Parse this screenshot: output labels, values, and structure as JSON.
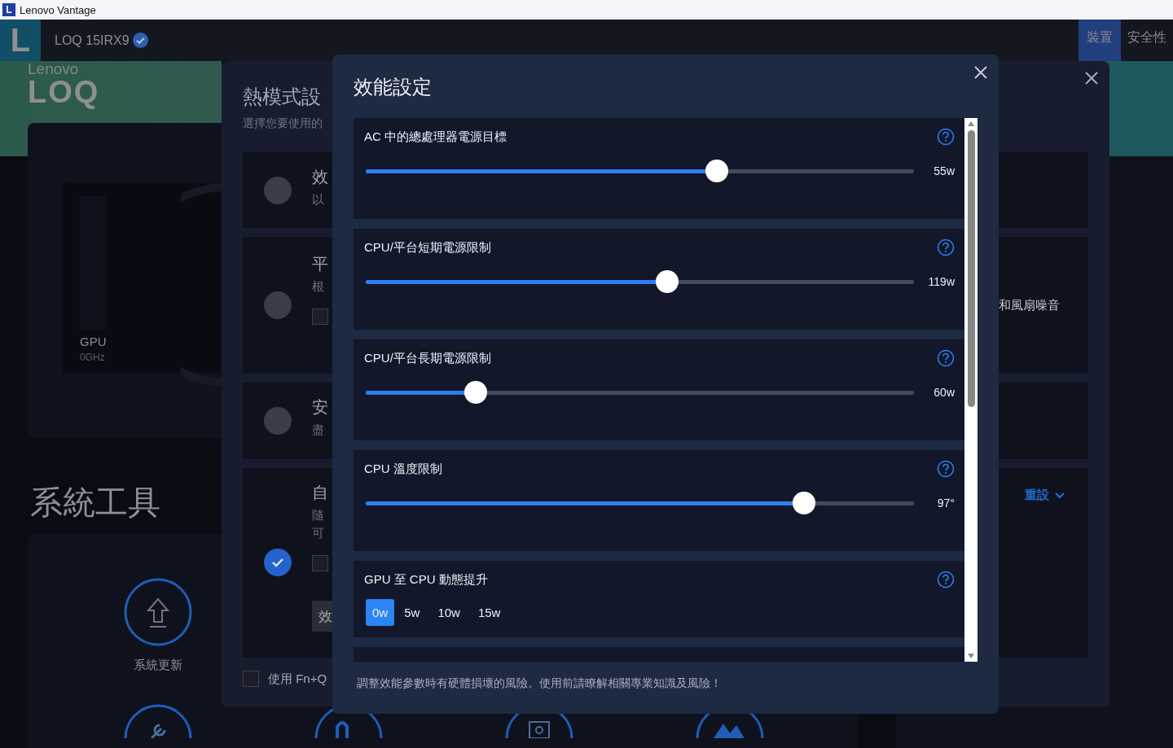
{
  "window": {
    "title": "Lenovo Vantage",
    "icon_letter": "L"
  },
  "header": {
    "logo_letter": "L",
    "device": "LOQ 15IRX9",
    "verified": true,
    "tabs": [
      {
        "label": "裝置",
        "selected": true
      },
      {
        "label": "安全性",
        "selected": false
      }
    ]
  },
  "banner": {
    "brand": "Lenovo",
    "logo": "LOQ"
  },
  "gpu": {
    "label": "GPU",
    "value": "0GHz"
  },
  "tools": {
    "title": "系統工具",
    "items": [
      {
        "label": "系統更新"
      }
    ]
  },
  "thermal_dialog": {
    "title": "熱模式設",
    "subtitle": "選擇您要使用的",
    "modes": [
      {
        "title": "效",
        "desc": [
          "以"
        ],
        "selected": false
      },
      {
        "title": "平",
        "desc": [
          "根"
        ],
        "selected": false,
        "checkbox": {
          "checked": false
        },
        "side_text": "和風扇噪音"
      },
      {
        "title": "安",
        "desc": [
          "盡"
        ],
        "selected": false
      },
      {
        "title": "自",
        "desc": [
          "隨",
          "可"
        ],
        "selected": true,
        "checkbox": {
          "checked": false
        },
        "button": "效",
        "side_link": "重設"
      }
    ],
    "fn_q": {
      "label": "使用 Fn+Q",
      "checked": false
    }
  },
  "performance_dialog": {
    "title": "效能設定",
    "settings": [
      {
        "kind": "slider",
        "label": "AC 中的總處理器電源目標",
        "level": 0.64,
        "reading": "55w"
      },
      {
        "kind": "slider",
        "label": "CPU/平台短期電源限制",
        "level": 0.55,
        "reading": "119w"
      },
      {
        "kind": "slider",
        "label": "CPU/平台長期電源限制",
        "level": 0.2,
        "reading": "60w"
      },
      {
        "kind": "slider",
        "label": "CPU 溫度限制",
        "level": 0.8,
        "reading": "97°"
      },
      {
        "kind": "options",
        "label": "GPU 至 CPU 動態提升",
        "options": [
          {
            "label": "0w",
            "selected": true
          },
          {
            "label": "5w",
            "selected": false
          },
          {
            "label": "10w",
            "selected": false
          },
          {
            "label": "15w",
            "selected": false
          }
        ]
      }
    ],
    "warning": "調整效能參數時有硬體損壞的風險。使用前請瞭解相關專業知識及風險！"
  }
}
